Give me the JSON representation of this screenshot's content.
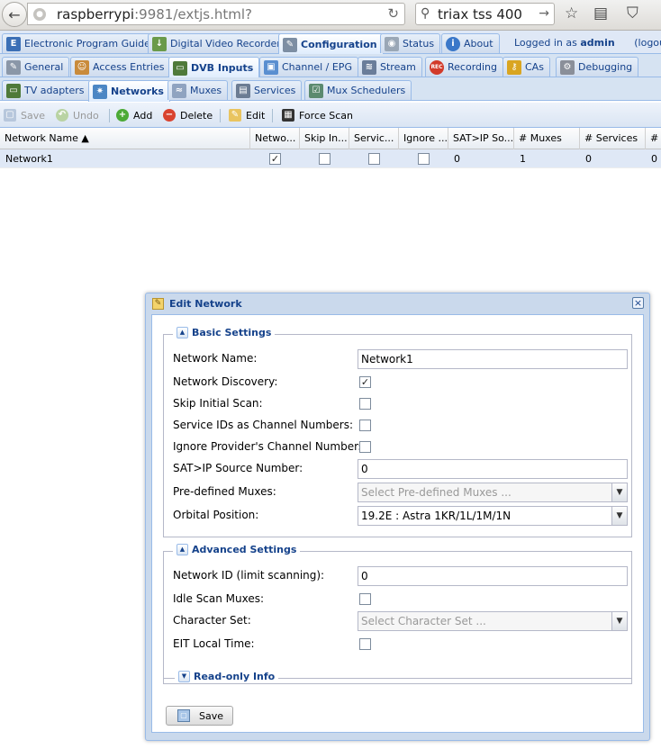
{
  "browser": {
    "url_host": "raspberrypi",
    "url_rest": ":9981/extjs.html?",
    "search_query": "triax tss 400"
  },
  "main_tabs": [
    {
      "label": "Electronic Program Guide",
      "icon": "epg-icon"
    },
    {
      "label": "Digital Video Recorder",
      "icon": "download-icon"
    },
    {
      "label": "Configuration",
      "icon": "wrench-icon",
      "active": true
    },
    {
      "label": "Status",
      "icon": "eye-icon"
    },
    {
      "label": "About",
      "icon": "info-icon"
    }
  ],
  "login": {
    "prefix": "Logged in as",
    "user": "admin",
    "logout": "(logout)"
  },
  "config_tabs": [
    {
      "label": "General",
      "icon": "wrench-icon"
    },
    {
      "label": "Access Entries",
      "icon": "users-icon"
    },
    {
      "label": "DVB Inputs",
      "icon": "card-icon",
      "active": true
    },
    {
      "label": "Channel / EPG",
      "icon": "tv-icon"
    },
    {
      "label": "Stream",
      "icon": "stream-icon"
    },
    {
      "label": "Recording",
      "icon": "rec-icon"
    },
    {
      "label": "CAs",
      "icon": "key-icon"
    },
    {
      "label": "Debugging",
      "icon": "gears-icon"
    }
  ],
  "dvb_tabs": [
    {
      "label": "TV adapters",
      "icon": "adapter-icon"
    },
    {
      "label": "Networks",
      "icon": "antenna-icon",
      "active": true
    },
    {
      "label": "Muxes",
      "icon": "muxes-icon"
    },
    {
      "label": "Services",
      "icon": "services-icon"
    },
    {
      "label": "Mux Schedulers",
      "icon": "scheduler-icon"
    }
  ],
  "toolbar": {
    "save": "Save",
    "undo": "Undo",
    "add": "Add",
    "delete": "Delete",
    "edit": "Edit",
    "force_scan": "Force Scan"
  },
  "grid": {
    "columns": [
      "Network Name ▲",
      "Netwo...",
      "Skip In...",
      "Servic...",
      "Ignore ...",
      "SAT>IP So...",
      "# Muxes",
      "# Services",
      "# I"
    ],
    "rows": [
      {
        "name": "Network1",
        "discovery": true,
        "skip": false,
        "service_ids": false,
        "ignore": false,
        "satip": "0",
        "muxes": "1",
        "services": "0",
        "extra": "0"
      }
    ]
  },
  "modal": {
    "title": "Edit Network",
    "basic_legend": "Basic Settings",
    "advanced_legend": "Advanced Settings",
    "readonly_legend": "Read-only Info",
    "save_label": "Save",
    "fields": {
      "network_name_label": "Network Name:",
      "network_name_value": "Network1",
      "network_discovery_label": "Network Discovery:",
      "network_discovery_checked": true,
      "skip_initial_label": "Skip Initial Scan:",
      "skip_initial_checked": false,
      "service_ids_label": "Service IDs as Channel Numbers:",
      "service_ids_checked": false,
      "ignore_provider_label": "Ignore Provider's Channel Numbers:",
      "ignore_provider_checked": false,
      "satip_label": "SAT>IP Source Number:",
      "satip_value": "0",
      "predefined_label": "Pre-defined Muxes:",
      "predefined_placeholder": "Select Pre-defined Muxes ...",
      "orbital_label": "Orbital Position:",
      "orbital_value": "19.2E : Astra 1KR/1L/1M/1N",
      "network_id_label": "Network ID (limit scanning):",
      "network_id_value": "0",
      "idle_scan_label": "Idle Scan Muxes:",
      "idle_scan_checked": false,
      "charset_label": "Character Set:",
      "charset_placeholder": "Select Character Set ...",
      "eit_label": "EIT Local Time:",
      "eit_checked": false
    }
  },
  "colors": {
    "accent": "#15428b",
    "panel_border": "#99bbe8",
    "selected_row": "#dfe8f6"
  }
}
